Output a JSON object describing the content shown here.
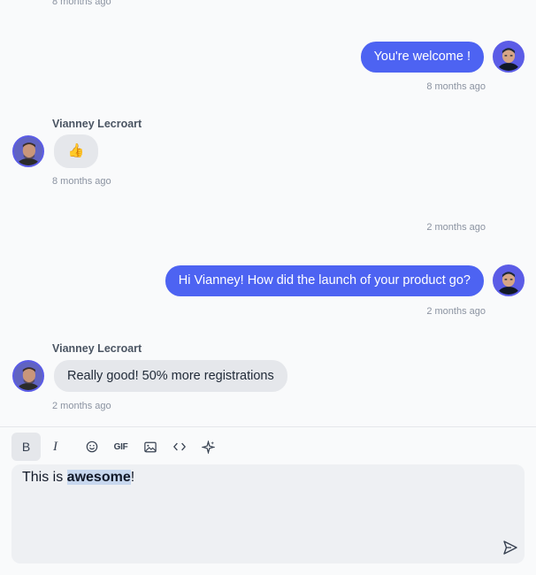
{
  "messages": {
    "top_timestamp": "8 months ago",
    "msg1": {
      "text": "You're welcome !",
      "time": "8 months ago"
    },
    "msg2": {
      "author": "Vianney Lecroart",
      "emoji": "👍",
      "time": "8 months ago"
    },
    "msg3_time_header": "2 months ago",
    "msg4": {
      "text": "Hi Vianney! How did the launch of your product go?",
      "time": "2 months ago"
    },
    "msg5": {
      "author": "Vianney Lecroart",
      "text": "Really good! 50% more registrations",
      "time": "2 months ago"
    }
  },
  "toolbar": {
    "bold": "B",
    "italic": "I",
    "gif": "GIF"
  },
  "editor": {
    "prefix": "This is ",
    "bold_word": "awesome",
    "suffix": "!"
  },
  "colors": {
    "outgoing_bubble": "#4d63f2",
    "incoming_bubble": "#e5e7eb",
    "selection": "#c7d7ee"
  }
}
